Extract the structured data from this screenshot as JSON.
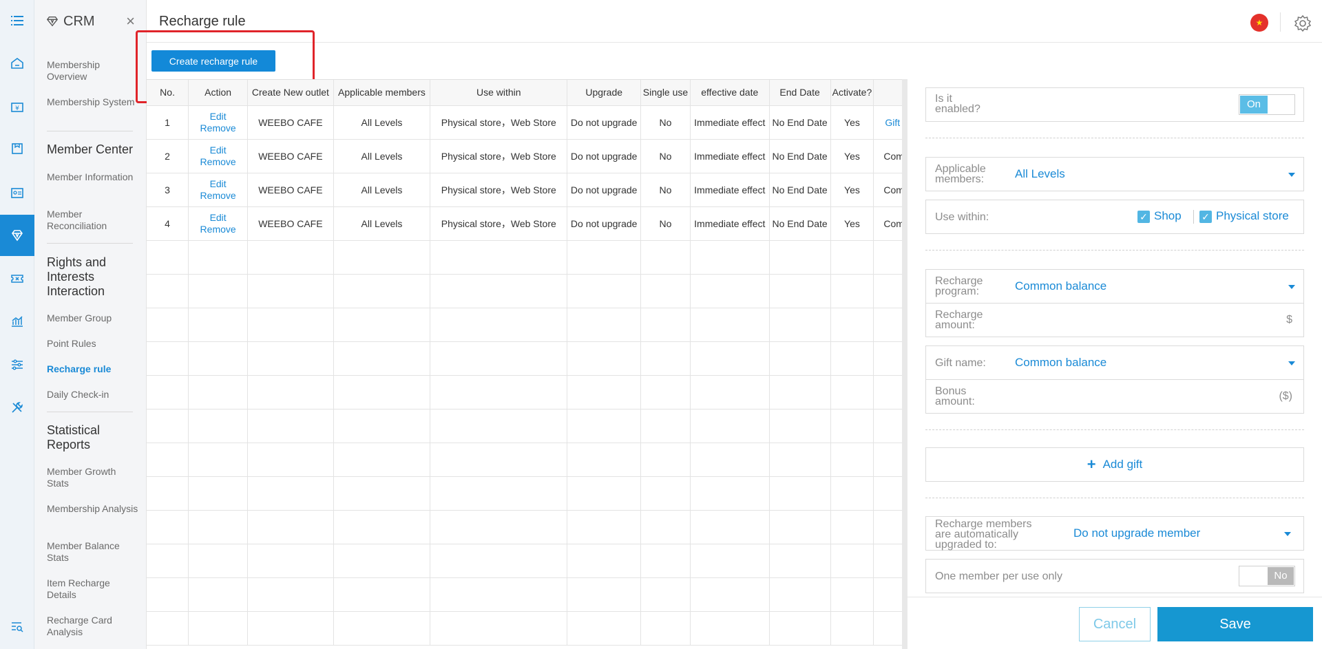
{
  "app": {
    "name": "CRM",
    "close": "×"
  },
  "header": {
    "title": "Recharge rule",
    "flag_glyph": "★"
  },
  "rail": {
    "icons": [
      "menu-icon",
      "home-icon",
      "cashier-icon",
      "shop-icon",
      "id-card-icon",
      "diamond-icon",
      "coupon-icon",
      "chart-icon",
      "sliders-icon",
      "tools-icon",
      "search-list-icon"
    ],
    "active_index": 5
  },
  "menu": {
    "items": {
      "membership_overview": "Membership Overview",
      "membership_system": "Membership System",
      "member_center": "Member Center",
      "member_information": "Member Information",
      "member_reconciliation": "Member Reconciliation",
      "rights": "Rights and Interests Interaction",
      "member_group": "Member Group",
      "point_rules": "Point Rules",
      "recharge_rule": "Recharge rule",
      "daily_checkin": "Daily Check-in",
      "statistical_reports": "Statistical Reports",
      "member_growth": "Member Growth Stats",
      "membership_analysis": "Membership Analysis",
      "member_balance": "Member Balance Stats",
      "item_recharge": "Item Recharge Details",
      "recharge_card": "Recharge Card Analysis"
    }
  },
  "toolbar": {
    "create_label": "Create recharge rule"
  },
  "table": {
    "headers": [
      "No.",
      "Action",
      "Create New outlet",
      "Applicable members",
      "Use within",
      "Upgrade",
      "Single use",
      "effective date",
      "End Date",
      "Activate?",
      ""
    ],
    "action_edit": "Edit",
    "action_remove": "Remove",
    "rows": [
      {
        "no": "1",
        "outlet": "WEEBO CAFE",
        "members": "All Levels",
        "use_within": "Physical store，Web Store",
        "upgrade": "Do not upgrade",
        "single": "No",
        "effective": "Immediate effect",
        "end": "No End Date",
        "activate": "Yes",
        "extra": "Gift"
      },
      {
        "no": "2",
        "outlet": "WEEBO CAFE",
        "members": "All Levels",
        "use_within": "Physical store，Web Store",
        "upgrade": "Do not upgrade",
        "single": "No",
        "effective": "Immediate effect",
        "end": "No End Date",
        "activate": "Yes",
        "extra": "Com"
      },
      {
        "no": "3",
        "outlet": "WEEBO CAFE",
        "members": "All Levels",
        "use_within": "Physical store，Web Store",
        "upgrade": "Do not upgrade",
        "single": "No",
        "effective": "Immediate effect",
        "end": "No End Date",
        "activate": "Yes",
        "extra": "Com"
      },
      {
        "no": "4",
        "outlet": "WEEBO CAFE",
        "members": "All Levels",
        "use_within": "Physical store，Web Store",
        "upgrade": "Do not upgrade",
        "single": "No",
        "effective": "Immediate effect",
        "end": "No End Date",
        "activate": "Yes",
        "extra": "Com"
      }
    ],
    "empty_rows": 12
  },
  "form": {
    "enabled_label": "Is it enabled?",
    "enabled_value": "On",
    "members_label": "Applicable members:",
    "members_value": "All Levels",
    "use_within_label": "Use within:",
    "shop_label": "Shop",
    "shop_checked": true,
    "physical_label": "Physical store",
    "physical_checked": true,
    "check_glyph": "✓",
    "program_label": "Recharge program:",
    "program_value": "Common balance",
    "amount_label": "Recharge amount:",
    "amount_value": "",
    "amount_unit": "$",
    "gift_label": "Gift name:",
    "gift_value": "Common balance",
    "bonus_label": "Bonus amount:",
    "bonus_value": "",
    "bonus_unit": "($)",
    "add_gift_plus": "+",
    "add_gift_label": "Add gift",
    "upgrade_label": "Recharge members are automatically upgraded to:",
    "upgrade_value": "Do not upgrade member",
    "one_per_use_label": "One member per use only",
    "one_per_use_value": "No",
    "cancel_label": "Cancel",
    "save_label": "Save"
  },
  "colors": {
    "accent": "#1a8ad6",
    "highlight": "#e0242a",
    "save": "#1697d1",
    "toggle_on": "#5bbde6"
  }
}
